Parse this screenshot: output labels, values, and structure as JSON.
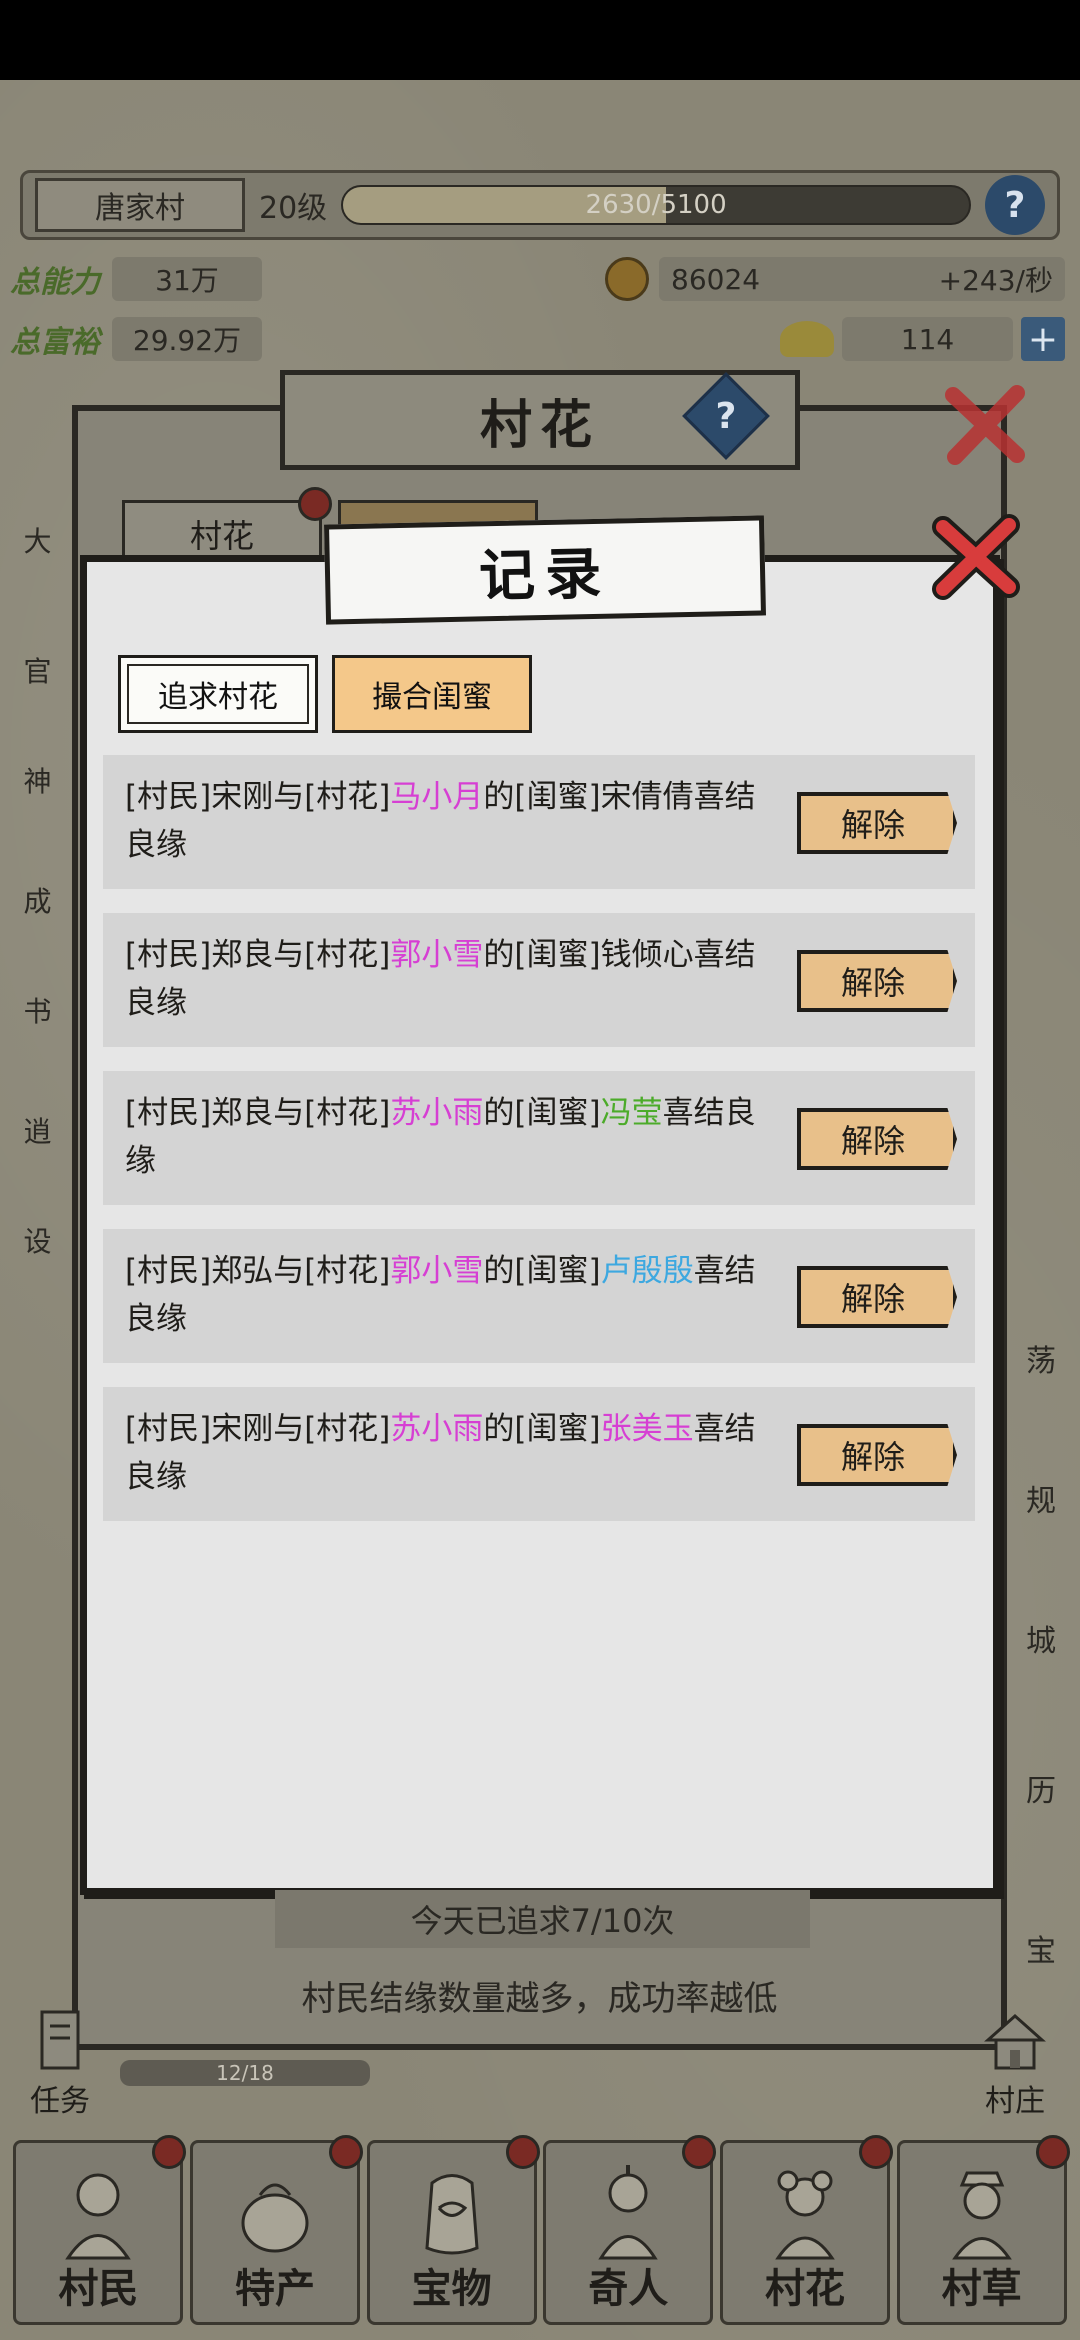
{
  "hud": {
    "village_name": "唐家村",
    "village_level": "20级",
    "exp_text": "2630/5100",
    "exp_fraction": 0.516,
    "total_power_label": "总能力",
    "total_power_value": "31万",
    "total_prosperity_label": "总富裕",
    "total_prosperity_value": "29.92万",
    "coins": "86024",
    "coins_rate": "+243/秒",
    "ingots": "114"
  },
  "back_panel": {
    "title": "村花",
    "tab_label": "村花",
    "daily_status": "今天已追求7/10次",
    "hint": "村民结缘数量越多，成功率越低"
  },
  "dialog": {
    "title": "记录",
    "tabs": [
      {
        "label": "追求村花",
        "active": false
      },
      {
        "label": "撮合闺蜜",
        "active": true
      }
    ],
    "dismiss_label": "解除",
    "records": [
      {
        "p1": "[村民]宋刚与[村花]",
        "flower": "马小月",
        "p2": "的[闺蜜]",
        "friend": "宋倩倩",
        "friend_color": "plain",
        "p3": "喜结良缘"
      },
      {
        "p1": "[村民]郑良与[村花]",
        "flower": "郭小雪",
        "p2": "的[闺蜜]",
        "friend": "钱倾心",
        "friend_color": "plain",
        "p3": "喜结良缘"
      },
      {
        "p1": "[村民]郑良与[村花]",
        "flower": "苏小雨",
        "p2": "的[闺蜜]",
        "friend": "冯莹",
        "friend_color": "green",
        "p3": "喜结良缘"
      },
      {
        "p1": "[村民]郑弘与[村花]",
        "flower": "郭小雪",
        "p2": "的[闺蜜]",
        "friend": "卢殷殷",
        "friend_color": "blue",
        "p3": "喜结良缘"
      },
      {
        "p1": "[村民]宋刚与[村花]",
        "flower": "苏小雨",
        "p2": "的[闺蜜]",
        "friend": "张美玉",
        "friend_color": "pink",
        "p3": "喜结良缘"
      }
    ]
  },
  "side": {
    "left": [
      "大",
      "官",
      "神",
      "成",
      "书",
      "逍",
      "设"
    ],
    "right": [
      "荡",
      "规",
      "城",
      "历",
      "宝"
    ],
    "task_label": "任务",
    "task_progress": "12/18",
    "manor_label": "村庄"
  },
  "bottom_nav": [
    {
      "label": "村民",
      "icon": "villager-icon"
    },
    {
      "label": "特产",
      "icon": "specialty-icon"
    },
    {
      "label": "宝物",
      "icon": "treasure-icon"
    },
    {
      "label": "奇人",
      "icon": "stranger-icon"
    },
    {
      "label": "村花",
      "icon": "village-beauty-icon"
    },
    {
      "label": "村草",
      "icon": "village-heartthrob-icon"
    }
  ],
  "colors": {
    "accent_pink": "#d63fd3",
    "accent_green": "#4cab2a",
    "accent_blue": "#3da8e0",
    "active_tab": "#f4c88a",
    "dismiss_button": "#e8c08a",
    "close_x": "#d83c3c"
  }
}
